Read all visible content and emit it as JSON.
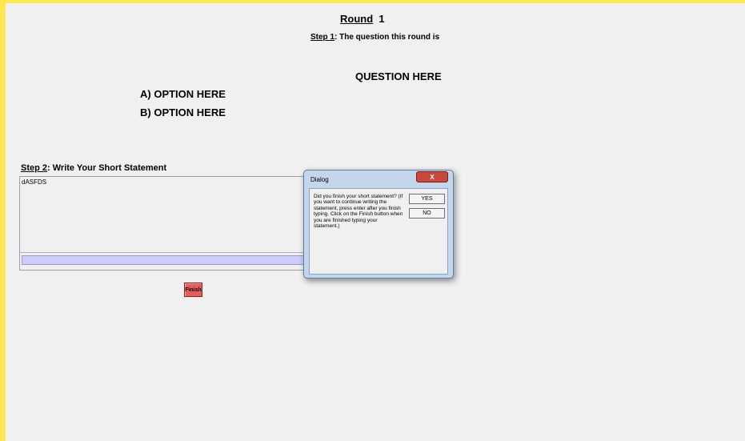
{
  "header": {
    "round_label": "Round",
    "round_number": "1",
    "step1_label": "Step 1",
    "step1_text": ":  The question this round is"
  },
  "question": {
    "text": "QUESTION HERE",
    "option_a": "A) OPTION HERE",
    "option_b": "B) OPTION HERE"
  },
  "step2": {
    "label": "Step 2",
    "text": ": Write Your Short Statement"
  },
  "statement": {
    "value": "dASFDS",
    "input_value": ""
  },
  "finish_button": {
    "label": "Finish"
  },
  "dialog": {
    "title": "Dialog",
    "close_label": "X",
    "message": "Did you finish your short statement? (If you want to continue writing the statement, press enter after you finish typing. Click on the Finish button when you are finished typing your statement.)",
    "yes_label": "YES",
    "no_label": "NO"
  },
  "colors": {
    "border_accent": "#ffe84d",
    "input_fill": "#ccccff",
    "finish_button": "#e85c5c",
    "close_button": "#c9483b"
  }
}
